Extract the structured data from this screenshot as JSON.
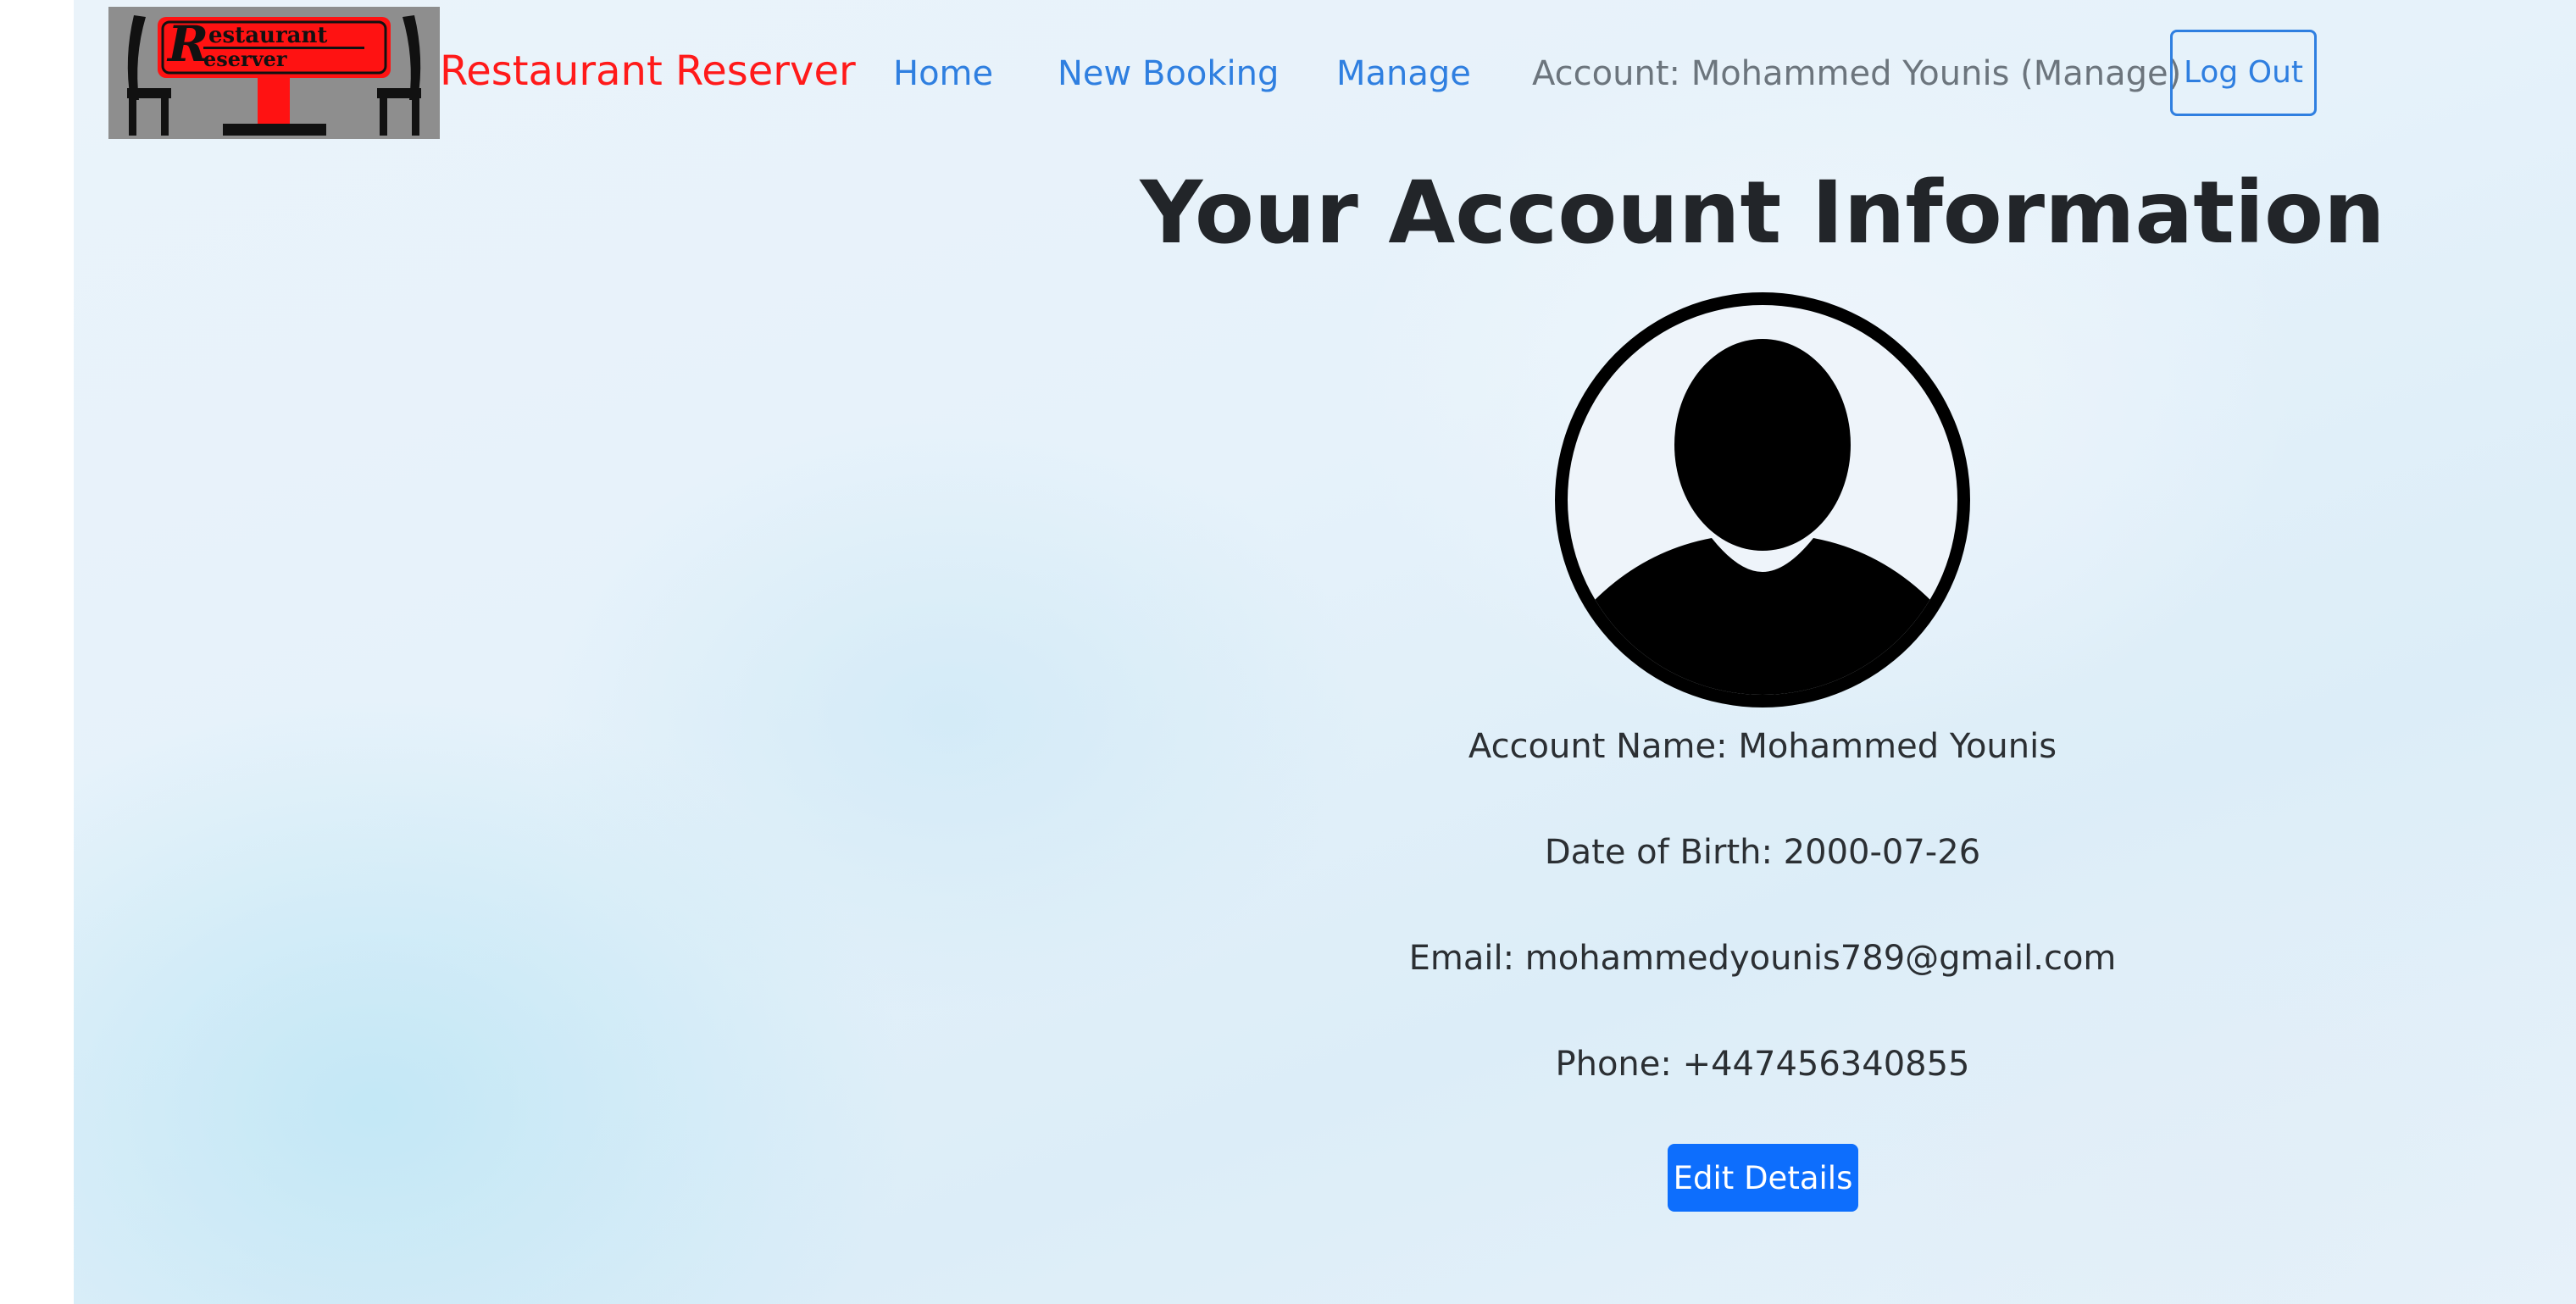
{
  "navbar": {
    "logo_text_top": "estaurant",
    "logo_text_bottom": "eserver",
    "logo_letter": "R",
    "brand": "Restaurant Reserver",
    "links": {
      "home": "Home",
      "new_booking": "New Booking",
      "manage": "Manage"
    },
    "account_text": "Account: Mohammed Younis (Manage)",
    "logout_label": "Log Out"
  },
  "main": {
    "title": "Your Account Information",
    "account_name": "Account Name: Mohammed Younis",
    "date_of_birth": "Date of Birth: 2000-07-26",
    "email": "Email: mohammedyounis789@gmail.com",
    "phone": "Phone: +447456340855",
    "edit_label": "Edit Details"
  },
  "colors": {
    "brand": "#ff1a1a",
    "link": "#2f7fe0",
    "primary_button": "#0d6efd",
    "heading": "#222529"
  }
}
